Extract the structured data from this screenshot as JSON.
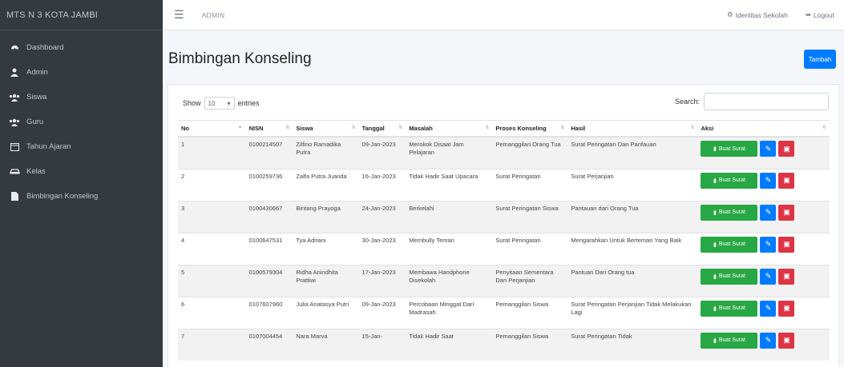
{
  "sidebar": {
    "brand": "MTS N 3 KOTA JAMBI",
    "items": [
      {
        "label": "Dashboard",
        "icon": "dashboard-icon"
      },
      {
        "label": "Admin",
        "icon": "user-icon"
      },
      {
        "label": "Siswa",
        "icon": "users-icon"
      },
      {
        "label": "Guru",
        "icon": "users-icon"
      },
      {
        "label": "Tahun Ajaran",
        "icon": "calendar-icon"
      },
      {
        "label": "Kelas",
        "icon": "car-icon"
      },
      {
        "label": "Bimbingan Konseling",
        "icon": "file-icon"
      }
    ]
  },
  "topbar": {
    "user": "ADMIN",
    "identity": "Identitas Sekolah",
    "logout": "Logout"
  },
  "page": {
    "title": "Bimbingan Konseling",
    "add_button": "Tambah"
  },
  "table_controls": {
    "show_label": "Show",
    "entries_value": "10",
    "entries_label": "entries",
    "search_label": "Search:"
  },
  "table": {
    "columns": [
      "No",
      "NISN",
      "Siswa",
      "Tanggal",
      "Masalah",
      "Proses Konseling",
      "Hasil",
      "Aksi"
    ],
    "print_label": "Buat Surat",
    "rows": [
      {
        "no": "1",
        "nisn": "0100214507",
        "siswa": "Zilfino Ramadika Putra",
        "tanggal": "09-Jan-2023",
        "masalah": "Merokok Disaat Jam Pelajaran",
        "proses": "Pemanggilan Orang Tua",
        "hasil": "Surat Peringatan Dan Panfauan"
      },
      {
        "no": "2",
        "nisn": "0100259736",
        "siswa": "Zalfa Putra Juanda",
        "tanggal": "16-Jan-2023",
        "masalah": "Tidak Hadir Saat Upacara",
        "proses": "Surat Peringatan",
        "hasil": "Surat Perjanjian"
      },
      {
        "no": "3",
        "nisn": "0100430667",
        "siswa": "Bintang Prayoga",
        "tanggal": "24-Jan-2023",
        "masalah": "Berkelahi",
        "proses": "Surat Peringatan Siswa",
        "hasil": "Pantauan dari Orang Tua"
      },
      {
        "no": "4",
        "nisn": "0100647531",
        "siswa": "Tya Adriani",
        "tanggal": "30-Jan-2023",
        "masalah": "Membully Teman",
        "proses": "Surat Peringatan",
        "hasil": "Mengarahkan Untuk Berteman Yang Baik"
      },
      {
        "no": "5",
        "nisn": "0100579304",
        "siswa": "Ridha Anindhita Prattiwi",
        "tanggal": "17-Jan-2023",
        "masalah": "Membawa Handphone Disekolah",
        "proses": "Penyitaan Sementara Dan Perjanjian",
        "hasil": "Pantuan Dari Orang tua"
      },
      {
        "no": "6",
        "nisn": "0107607960",
        "siswa": "Julia Anatasya Putri",
        "tanggal": "09-Jan-2023",
        "masalah": "Percobaan Minggat Dari Madrasah",
        "proses": "Pemanggilan Siswa",
        "hasil": "Surat Peringatan Perjanjian Tidak Melakukan Lagi"
      },
      {
        "no": "7",
        "nisn": "0107004454",
        "siswa": "Nara Marva",
        "tanggal": "15-Jan-",
        "masalah": "Tidak Hadir Saat",
        "proses": "Pemanggilan Siswa",
        "hasil": "Surat Peringatan Tidak"
      }
    ]
  },
  "colors": {
    "sidebar_bg": "#343a40",
    "primary": "#007bff",
    "success": "#28a745",
    "danger": "#dc3545"
  }
}
